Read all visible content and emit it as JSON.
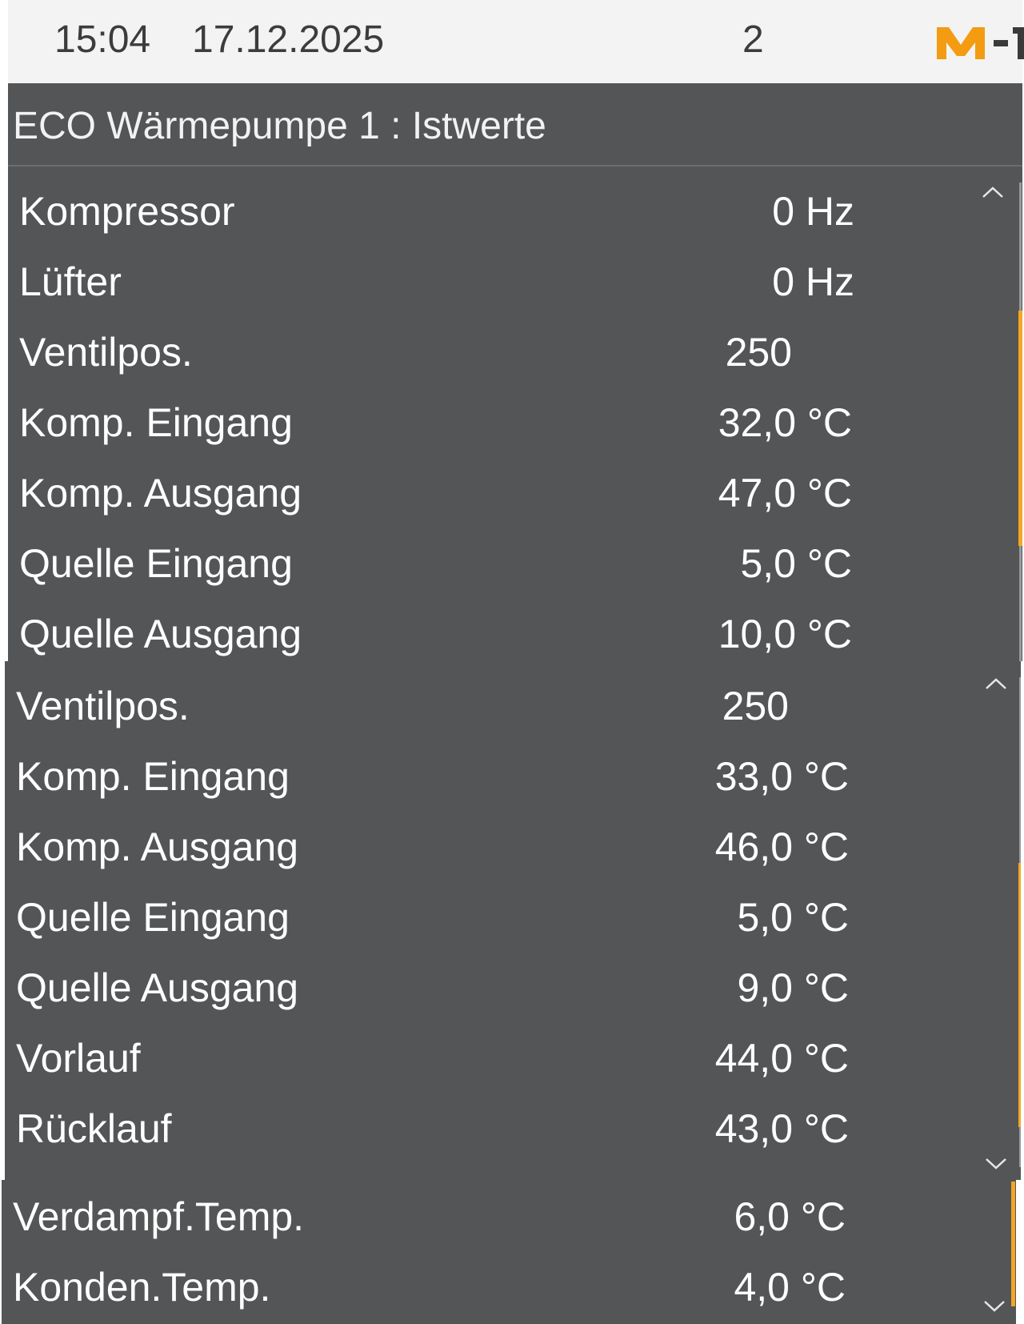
{
  "status_bar": {
    "time": "15:04",
    "date": "17.12.2025",
    "number": "2",
    "logo_color": "#f39c12"
  },
  "title": "ECO Wärmepumpe 1 : Istwerte",
  "panel_a": {
    "rows": [
      {
        "label": "Kompressor",
        "value": "0 Hz"
      },
      {
        "label": "Lüfter",
        "value": "0 Hz"
      },
      {
        "label": "Ventilpos.",
        "value": "250"
      },
      {
        "label": "Komp. Eingang",
        "value": "32,0 °C"
      },
      {
        "label": "Komp. Ausgang",
        "value": "47,0 °C"
      },
      {
        "label": "Quelle Eingang",
        "value": "5,0 °C"
      },
      {
        "label": "Quelle Ausgang",
        "value": "10,0 °C"
      }
    ]
  },
  "panel_b": {
    "rows": [
      {
        "label": "Ventilpos.",
        "value": "250"
      },
      {
        "label": "Komp. Eingang",
        "value": "33,0 °C"
      },
      {
        "label": "Komp. Ausgang",
        "value": "46,0 °C"
      },
      {
        "label": "Quelle Eingang",
        "value": "5,0 °C"
      },
      {
        "label": "Quelle Ausgang",
        "value": "9,0 °C"
      },
      {
        "label": "Vorlauf",
        "value": "44,0 °C"
      },
      {
        "label": "Rücklauf",
        "value": "43,0 °C"
      }
    ]
  },
  "panel_c": {
    "rows": [
      {
        "label": "Verdampf.Temp.",
        "value": "6,0 °C"
      },
      {
        "label": "Konden.Temp.",
        "value": "4,0 °C"
      }
    ]
  },
  "colors": {
    "panel_bg": "#535557",
    "accent": "#f5a623",
    "status_bg": "#f3f3f3"
  },
  "icons": {
    "scroll_up": "chevron-up-icon",
    "scroll_down": "chevron-down-icon"
  }
}
